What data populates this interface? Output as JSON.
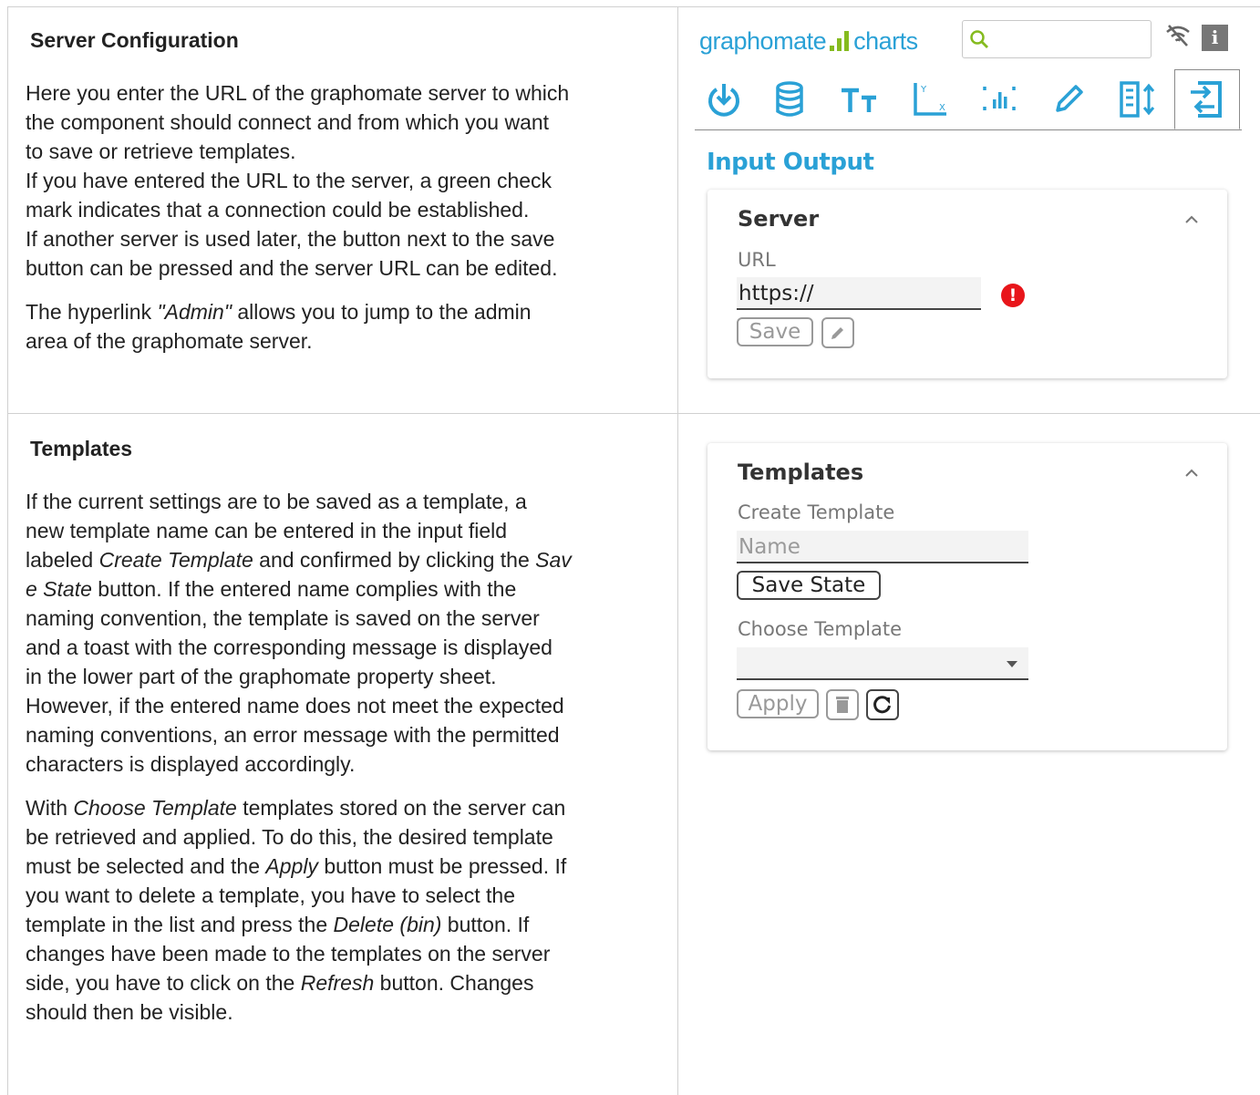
{
  "server_config": {
    "heading": "Server Configuration",
    "para1_lines": [
      "Here you enter the URL of the graphomate server to which",
      "the component should connect and from which you want",
      "to save or retrieve templates.",
      "If you have entered the URL to the server, a green check",
      "mark indicates that a connection could be established.",
      "If another server is used later, the button next to the save",
      "button can be pressed and the server URL can be edited."
    ],
    "para2_prefix": "The hyperlink ",
    "para2_link": "\"Admin\"",
    "para2_line1_rest": " allows you to jump to the admin",
    "para2_line2": "area of the graphomate server."
  },
  "templates_doc": {
    "heading": "Templates",
    "p1": {
      "l1": "If the current settings are to be saved as a template, a",
      "l2": "new template name can be entered in the input field",
      "l3_a": "labeled ",
      "l3_em": "Create Template",
      "l3_b": " and confirmed by clicking the ",
      "l3_em2": "Sav",
      "l4_em": "e State",
      "l4_b": " button. If the entered name complies with the",
      "l5": "naming convention, the template is saved on the server",
      "l6": "and a toast with the corresponding message is displayed",
      "l7": "in the lower part of the graphomate property sheet.",
      "l8": "However, if the entered name does not meet the expected",
      "l9": "naming conventions, an error message with the permitted",
      "l10": "characters is displayed accordingly."
    },
    "p2": {
      "l1_a": "With ",
      "l1_em": "Choose Template",
      "l1_b": " templates stored on the server can",
      "l2": "be retrieved and applied. To do this, the desired template",
      "l3_a": "must be selected and the ",
      "l3_em": "Apply",
      "l3_b": " button must be pressed. If",
      "l4": "you want to delete a template, you have to select the",
      "l5_a": "template in the list and press the ",
      "l5_em": "Delete (bin)",
      "l5_b": " button. If",
      "l6": "changes have been made to the templates on the server",
      "l7_a": "side, you have to click on the ",
      "l7_em": "Refresh",
      "l7_b": " button. Changes",
      "l8": "should then be visible."
    }
  },
  "panel": {
    "logo_part1": "grapho",
    "logo_part2": "mate",
    "logo_part3": "charts",
    "section_title": "Input Output",
    "server_card": {
      "title": "Server",
      "url_label": "URL",
      "url_value": "https://",
      "error_mark": "!",
      "save_label": "Save"
    },
    "templates_card": {
      "title": "Templates",
      "create_label": "Create Template",
      "name_placeholder": "Name",
      "save_state_label": "Save State",
      "choose_label": "Choose Template",
      "apply_label": "Apply"
    },
    "colors": {
      "accent": "#2aa1d6",
      "logo_bars": "#85bb1f",
      "error": "#e8151a"
    }
  }
}
